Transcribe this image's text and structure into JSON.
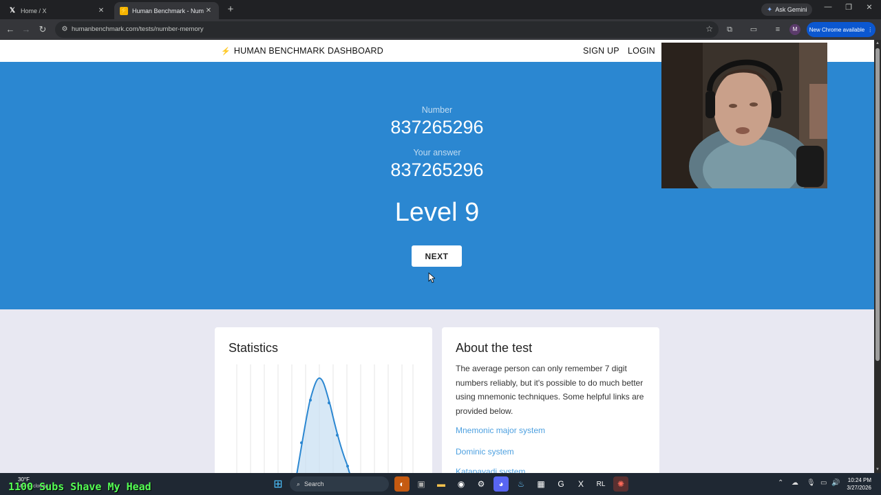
{
  "browser": {
    "tabs": [
      {
        "title": "Home / X",
        "favicon": "x-logo-icon"
      },
      {
        "title": "Human Benchmark - Number M",
        "favicon": "human-benchmark-icon"
      }
    ],
    "ask_gemini": "Ask Gemini",
    "url": "humanbenchmark.com/tests/number-memory",
    "new_chrome": "New Chrome available",
    "profile_initial": "M"
  },
  "site_nav": {
    "brand": "HUMAN BENCHMARK",
    "dashboard": "DASHBOARD",
    "signup": "SIGN UP",
    "login": "LOGIN"
  },
  "test": {
    "number_label": "Number",
    "number": "837265296",
    "answer_label": "Your answer",
    "answer": "837265296",
    "level": "Level 9",
    "next_label": "NEXT"
  },
  "stats_card": {
    "title": "Statistics"
  },
  "about_card": {
    "title": "About the test",
    "description": "The average person can only remember 7 digit numbers reliably, but it's possible to do much better using mnemonic techniques. Some helpful links are provided below.",
    "links": [
      "Mnemonic major system",
      "Dominic system",
      "Katapayadi system"
    ]
  },
  "taskbar": {
    "weather_temp": "30°F",
    "weather_desc": "Mostly cloudy",
    "overlay": "1100 Subs Shave My Head",
    "search": "Search",
    "time": "10:24 PM",
    "date": "3/27/2026"
  },
  "colors": {
    "hero_blue": "#2b87d1",
    "link_blue": "#4da0e0",
    "page_bg": "#e8e8f2",
    "overlay_green": "#55ff55"
  }
}
